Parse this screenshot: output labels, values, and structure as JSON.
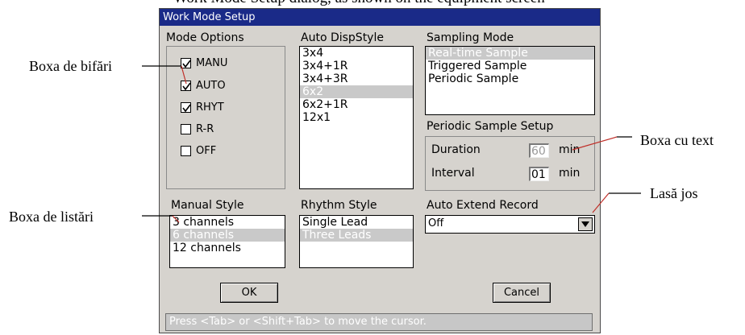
{
  "caption_fragment": "Work Mode Setup dialog, as shown on the equipment screen",
  "annotations": {
    "checkbox_box": "Boxa de bifări",
    "list_box": "Boxa de listări",
    "text_box": "Boxa cu text",
    "dropdown": "Lasă jos"
  },
  "window": {
    "title": "Work Mode Setup"
  },
  "mode_options": {
    "label": "Mode Options",
    "items": [
      {
        "label": "MANU",
        "checked": true
      },
      {
        "label": "AUTO",
        "checked": true
      },
      {
        "label": "RHYT",
        "checked": true
      },
      {
        "label": "R-R",
        "checked": false
      },
      {
        "label": "OFF",
        "checked": false
      }
    ]
  },
  "auto_disp_style": {
    "label": "Auto  DispStyle",
    "items": [
      "3x4",
      "3x4+1R",
      "3x4+3R",
      "6x2",
      "6x2+1R",
      "12x1"
    ],
    "selected": "6x2"
  },
  "sampling_mode": {
    "label": "Sampling Mode",
    "items": [
      "Real-time Sample",
      "Triggered Sample",
      "Periodic Sample"
    ],
    "selected": "Real-time Sample"
  },
  "periodic_setup": {
    "label": "Periodic Sample Setup",
    "duration_label": "Duration",
    "duration_value": "60",
    "duration_unit": "min",
    "interval_label": "Interval",
    "interval_value": "01",
    "interval_unit": "min"
  },
  "manual_style": {
    "label": "Manual Style",
    "items": [
      "3 channels",
      "6 channels",
      "12 channels"
    ],
    "selected": "6 channels"
  },
  "rhythm_style": {
    "label": "Rhythm Style",
    "items": [
      "Single Lead",
      "Three Leads"
    ],
    "selected": "Three Leads"
  },
  "auto_extend": {
    "label": "Auto Extend Record",
    "value": "Off"
  },
  "buttons": {
    "ok": "OK",
    "cancel": "Cancel"
  },
  "status_bar": "Press <Tab> or <Shift+Tab> to move the cursor."
}
